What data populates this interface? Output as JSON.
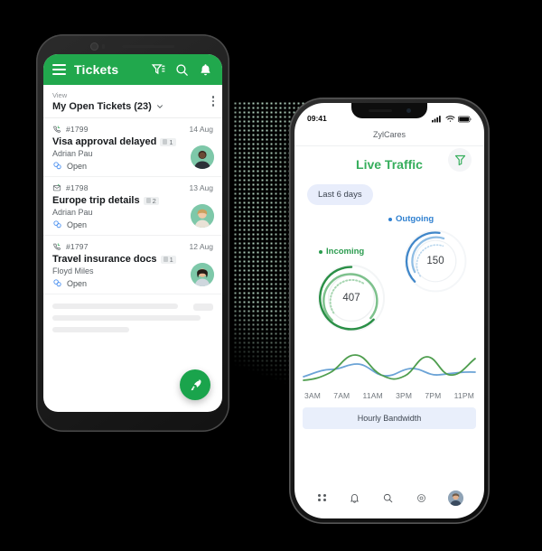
{
  "android": {
    "app_bar": {
      "menu_icon": "hamburger-icon",
      "title": "Tickets",
      "filter_icon": "filter-icon",
      "search_icon": "search-icon",
      "bell_icon": "bell-icon",
      "bg_color": "#21a84d"
    },
    "view_selector": {
      "label": "View",
      "value": "My Open Tickets (23)",
      "chevron": "chevron-down-icon",
      "overflow_icon": "kebab-menu-icon"
    },
    "tickets": [
      {
        "channel_icon": "phone-incoming-icon",
        "id": "#1799",
        "date": "14 Aug",
        "subject": "Visa approval delayed",
        "thread_count": "1",
        "contact": "Adrian Pau",
        "status": "Open",
        "avatar_bg": "#7ec8a9"
      },
      {
        "channel_icon": "email-icon",
        "id": "#1798",
        "date": "13 Aug",
        "subject": "Europe trip details",
        "thread_count": "2",
        "contact": "Adrian Pau",
        "status": "Open",
        "avatar_bg": "#7ec8a9"
      },
      {
        "channel_icon": "phone-incoming-icon",
        "id": "#1797",
        "date": "12 Aug",
        "subject": "Travel insurance docs",
        "thread_count": "1",
        "contact": "Floyd Miles",
        "status": "Open",
        "avatar_bg": "#7ec8a9"
      }
    ],
    "fab": {
      "icon": "rocket-icon",
      "color": "#1aa44c"
    }
  },
  "iphone": {
    "status_bar": {
      "time": "09:41",
      "signal_icon": "cellular-signal-icon",
      "wifi_icon": "wifi-icon",
      "battery_icon": "battery-icon"
    },
    "app_title": "ZylCares",
    "page_title": "Live Traffic",
    "page_title_color": "#36ae5c",
    "filter_button_icon": "filter-icon",
    "range_chip": "Last 6 days",
    "gauges": [
      {
        "label": "Incoming",
        "value": "407",
        "color": "#2a9b4e",
        "dot_color": "#2a9b4e"
      },
      {
        "label": "Outgoing",
        "value": "150",
        "color": "#2f80d0",
        "dot_color": "#2f80d0"
      }
    ],
    "x_labels": [
      "3AM",
      "7AM",
      "11AM",
      "3PM",
      "7PM",
      "11PM"
    ],
    "band_label": "Hourly Bandwidth",
    "tabbar": [
      {
        "icon": "apps-grid-icon"
      },
      {
        "icon": "bell-icon"
      },
      {
        "icon": "search-icon"
      },
      {
        "icon": "gear-icon"
      },
      {
        "icon": "avatar"
      }
    ]
  },
  "chart_data": {
    "type": "line",
    "title": "Hourly Bandwidth",
    "xlabel": "",
    "ylabel": "",
    "grid": false,
    "legend_position": "above-chart",
    "x": [
      "3AM",
      "7AM",
      "11AM",
      "3PM",
      "7PM",
      "11PM"
    ],
    "series": [
      {
        "name": "Incoming",
        "color": "#4f9e4f",
        "total": 407,
        "values": [
          8,
          12,
          34,
          40,
          20,
          10,
          14,
          36,
          26,
          12,
          16,
          30,
          44
        ]
      },
      {
        "name": "Outgoing",
        "color": "#6ba3d6",
        "total": 150,
        "values": [
          16,
          22,
          26,
          20,
          14,
          18,
          28,
          24,
          14,
          18,
          26,
          22,
          24
        ]
      }
    ]
  },
  "backdrop": {
    "dot_color": "#b7d8c4",
    "pattern": "dot-grid"
  }
}
